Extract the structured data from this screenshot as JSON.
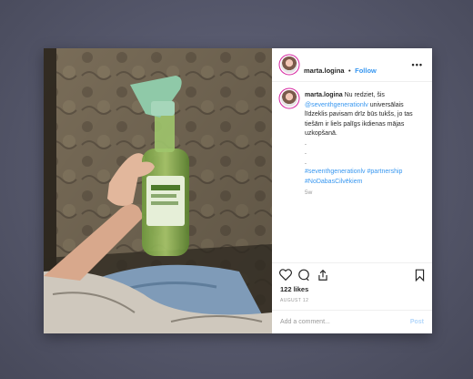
{
  "post": {
    "username": "marta.logina",
    "separator": "•",
    "follow_label": "Follow",
    "more_icon": "more-dots-icon",
    "caption": {
      "username": "marta.logina",
      "text_before": "Nu redziet, šis",
      "mention": "@seventhgenerationlv",
      "text_after": "universālais līdzeklis pavisam drīz būs tukšs, jo tas tiešām ir liels palīgs ikdienas mājas uzkopšanā.",
      "dots": [
        ".",
        ".",
        "."
      ],
      "hashtag_1": "#seventhgenerationlv",
      "hashtag_2": "#partnership",
      "hashtag_3": "#NoDabasCilvēkiem"
    },
    "time_ago": "5w",
    "likes": "122 likes",
    "date": "AUGUST 12",
    "comment_placeholder": "Add a comment...",
    "post_label": "Post",
    "icons": [
      "heart-icon",
      "comment-icon",
      "share-icon",
      "bookmark-icon"
    ],
    "colors": {
      "link": "#3897f0",
      "post_disabled": "#b3d7fb",
      "muted": "#999999"
    }
  }
}
